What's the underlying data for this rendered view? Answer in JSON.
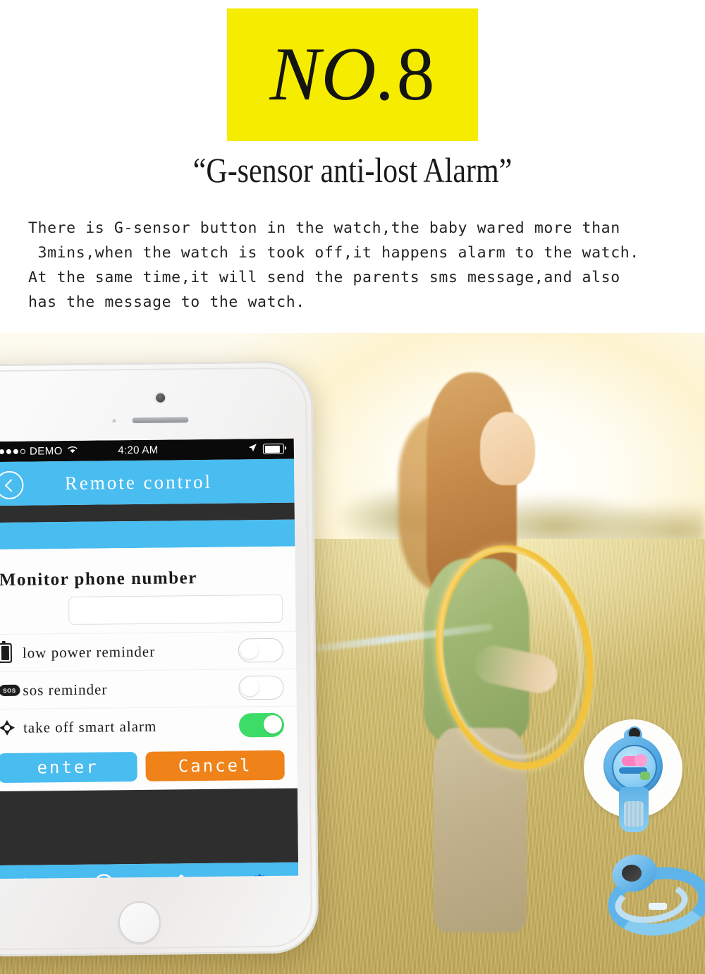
{
  "banner": {
    "prefix": "NO.",
    "number": "8"
  },
  "subtitle": "“G-sensor anti-lost Alarm”",
  "description": "There is G-sensor button in the watch,the baby wared more than\n 3mins,when the watch is took off,it happens alarm to the watch.\nAt the same time,it will send the parents sms message,and also\nhas the message to the watch.",
  "colors": {
    "banner_bg": "#f5ec00",
    "app_blue": "#49bcf0",
    "cancel_orange": "#ef8218",
    "toggle_on_green": "#3ddc66",
    "dark_strip": "#2e2e2e"
  },
  "phone": {
    "status_bar": {
      "carrier": "DEMO",
      "signal_dots_filled": 4,
      "signal_dots_total": 5,
      "wifi_icon": "wifi-icon",
      "time": "4:20 AM",
      "location_icon": "location-arrow-icon",
      "battery_icon": "battery-icon"
    },
    "nav": {
      "back_icon": "back-chevron-icon",
      "title": "Remote control"
    },
    "form": {
      "label": "Monitor phone number",
      "input_value": "",
      "input_placeholder": ""
    },
    "toggles": [
      {
        "icon": "battery-icon",
        "label": "low power reminder",
        "state": "off"
      },
      {
        "icon": "sos-icon",
        "label": "sos reminder",
        "state": "off"
      },
      {
        "icon": "alarm-icon",
        "label": "take off smart alarm",
        "state": "on"
      }
    ],
    "buttons": {
      "enter": "enter",
      "cancel": "Cancel"
    },
    "tabbar": [
      {
        "icon": "home-icon",
        "active": false
      },
      {
        "icon": "location-pin-icon",
        "active": false
      },
      {
        "icon": "microphone-icon",
        "active": false
      },
      {
        "icon": "gear-icon",
        "active": true
      }
    ]
  },
  "photo": {
    "callout_device": "kids-smartwatch-blue",
    "ground_device": "kids-smartwatch-on-grass"
  }
}
